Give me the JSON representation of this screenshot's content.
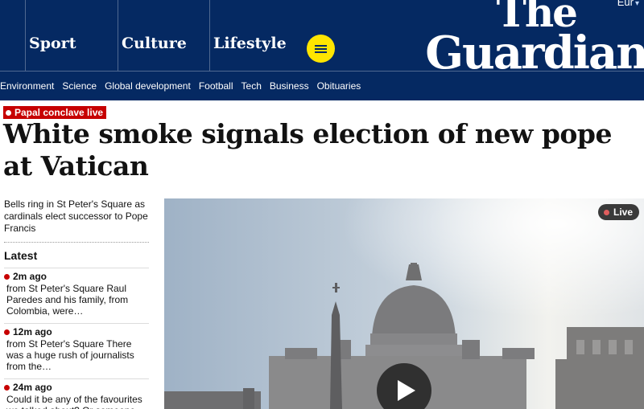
{
  "header": {
    "edition": "Eur",
    "pillars": [
      "Sport",
      "Culture",
      "Lifestyle"
    ],
    "logo_line1": "The",
    "logo_line2": "Guardian",
    "subnav": [
      "Environment",
      "Science",
      "Global development",
      "Football",
      "Tech",
      "Business",
      "Obituaries"
    ]
  },
  "article": {
    "kicker": "Papal conclave live",
    "headline": "White smoke signals election of new pope at Vatican",
    "standfirst": "Bells ring in St Peter's Square as cardinals elect successor to Pope Francis"
  },
  "latest": {
    "heading": "Latest",
    "items": [
      {
        "time": "2m ago",
        "text": "from St Peter's Square Raul Paredes and his family, from Colombia, were…"
      },
      {
        "time": "12m ago",
        "text": "from St Peter's Square There was a huge rush of journalists from the…"
      },
      {
        "time": "24m ago",
        "text": "Could it be any of the favourites we talked about? Or someone…"
      }
    ]
  },
  "media": {
    "live_label": "Live",
    "icons": [
      "live-dot-icon",
      "play-icon"
    ]
  },
  "colors": {
    "brand_blue": "#052962",
    "menu_yellow": "#ffe500",
    "live_red": "#c70000"
  }
}
